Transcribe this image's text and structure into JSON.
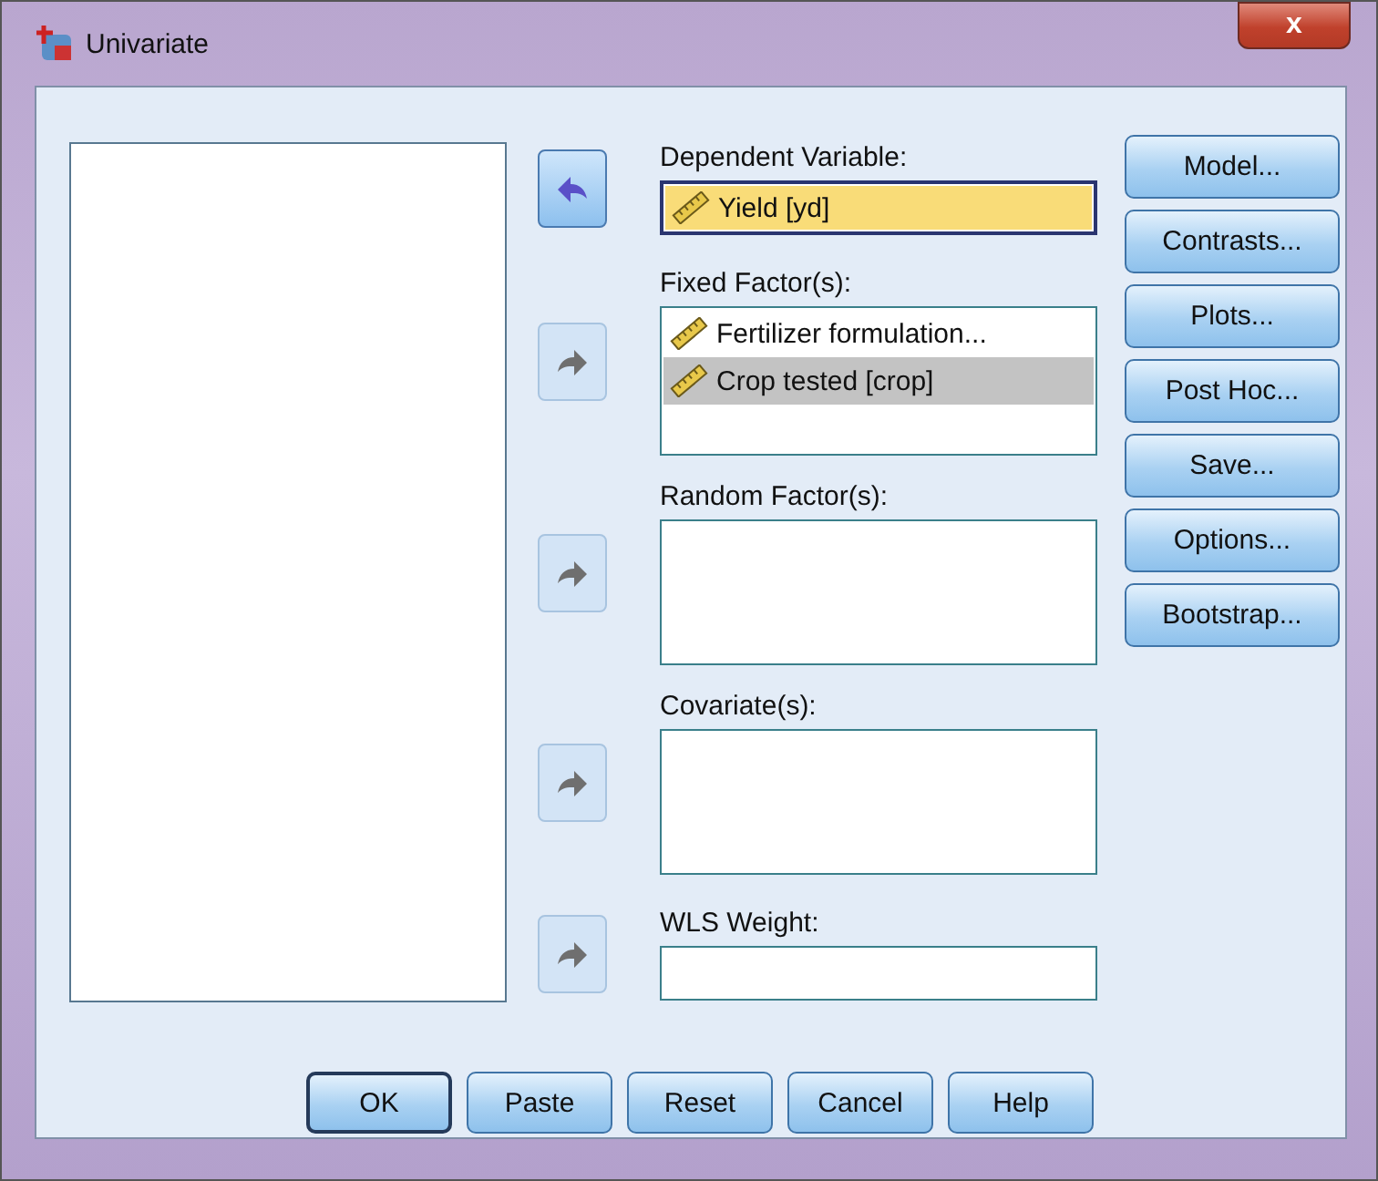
{
  "window": {
    "title": "Univariate",
    "close": "x"
  },
  "fields": [
    {
      "label": "Dependent Variable:",
      "kind": "single",
      "focused": true,
      "items": [
        {
          "text": "Yield [yd]",
          "selected": true
        }
      ]
    },
    {
      "label": "Fixed Factor(s):",
      "kind": "list",
      "focused": false,
      "items": [
        {
          "text": "Fertilizer formulation...",
          "selected": false
        },
        {
          "text": "Crop tested [crop]",
          "selected": true
        }
      ]
    },
    {
      "label": "Random Factor(s):",
      "kind": "box",
      "focused": false
    },
    {
      "label": "Covariate(s):",
      "kind": "box",
      "focused": false
    },
    {
      "label": "WLS Weight:",
      "kind": "single",
      "focused": false
    }
  ],
  "side_buttons": [
    "Model...",
    "Contrasts...",
    "Plots...",
    "Post Hoc...",
    "Save...",
    "Options...",
    "Bootstrap..."
  ],
  "bottom_buttons": [
    {
      "label": "OK",
      "default": true
    },
    {
      "label": "Paste",
      "default": false
    },
    {
      "label": "Reset",
      "default": false
    },
    {
      "label": "Cancel",
      "default": false
    },
    {
      "label": "Help",
      "default": false
    }
  ]
}
